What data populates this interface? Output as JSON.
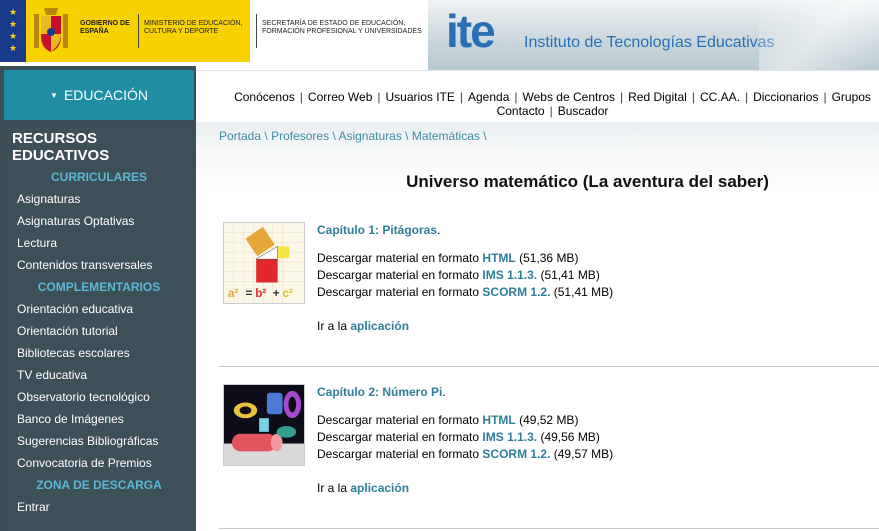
{
  "header": {
    "gov_name": "GOBIERNO DE ESPAÑA",
    "ministry": "MINISTERIO DE EDUCACIÓN, CULTURA Y DEPORTE",
    "secretaria": "SECRETARÍA DE ESTADO DE EDUCACIÓN, FORMACIÓN PROFESIONAL Y UNIVERSIDADES",
    "ite_logo": "ite",
    "ite_full": "Instituto de Tecnologías Educativas"
  },
  "sidebar": {
    "tab_label": "EDUCACIÓN",
    "title": "RECURSOS EDUCATIVOS",
    "sections": [
      {
        "heading": "CURRICULARES",
        "items": [
          "Asignaturas",
          "Asignaturas Optativas",
          "Lectura",
          "Contenidos transversales"
        ]
      },
      {
        "heading": "COMPLEMENTARIOS",
        "items": [
          "Orientación educativa",
          "Orientación tutorial",
          "Bibliotecas escolares",
          "TV educativa",
          "Observatorio tecnológico",
          "Banco de Imágenes",
          "Sugerencias Bibliográficas",
          "Convocatoria de Premios"
        ]
      },
      {
        "heading": "ZONA DE DESCARGA",
        "items": [
          "Entrar"
        ]
      }
    ]
  },
  "topnav": {
    "row1": [
      "Conócenos",
      "Correo Web",
      "Usuarios ITE",
      "Agenda",
      "Webs de Centros",
      "Red Digital",
      "CC.AA.",
      "Diccionarios",
      "Grupos"
    ],
    "row2": [
      "Contacto",
      "Buscador"
    ],
    "separator": "|"
  },
  "breadcrumb": [
    "Portada",
    "Profesores",
    "Asignaturas",
    "Matemáticas"
  ],
  "breadcrumb_sep": "\\",
  "page_title": "Universo matemático (La aventura del saber)",
  "chapters": [
    {
      "title": "Capítulo 1: Pitágoras",
      "title_suffix": ".",
      "image_icon": "pythagoras-thumbnail",
      "downloads": [
        {
          "prefix": "Descargar material en formato ",
          "format": "HTML",
          "size": "(51,36 MB)"
        },
        {
          "prefix": "Descargar material en formato ",
          "format": "IMS 1.1.3.",
          "size": "(51,41 MB)"
        },
        {
          "prefix": "Descargar material en formato ",
          "format": "SCORM 1.2.",
          "size": "(51,41 MB)"
        }
      ],
      "ir_prefix": "Ir a la ",
      "ir_link": "aplicación"
    },
    {
      "title": "Capítulo 2: Número Pi",
      "title_suffix": ".",
      "image_icon": "number-pi-thumbnail",
      "downloads": [
        {
          "prefix": "Descargar material en formato ",
          "format": "HTML",
          "size": "(49,52 MB)"
        },
        {
          "prefix": "Descargar material en formato ",
          "format": "IMS 1.1.3.",
          "size": "(49,56 MB)"
        },
        {
          "prefix": "Descargar material en formato ",
          "format": "SCORM 1.2.",
          "size": "(49,57 MB)"
        }
      ],
      "ir_prefix": "Ir a la ",
      "ir_link": "aplicación"
    }
  ],
  "colors": {
    "gov_yellow": "#f7d100",
    "ite_blue": "#2b6fb6",
    "sidebar_bg": "#3d5057",
    "tab_teal": "#1f8ea4",
    "section_blue": "#5ab8d3",
    "link_teal": "#2f7e97"
  }
}
